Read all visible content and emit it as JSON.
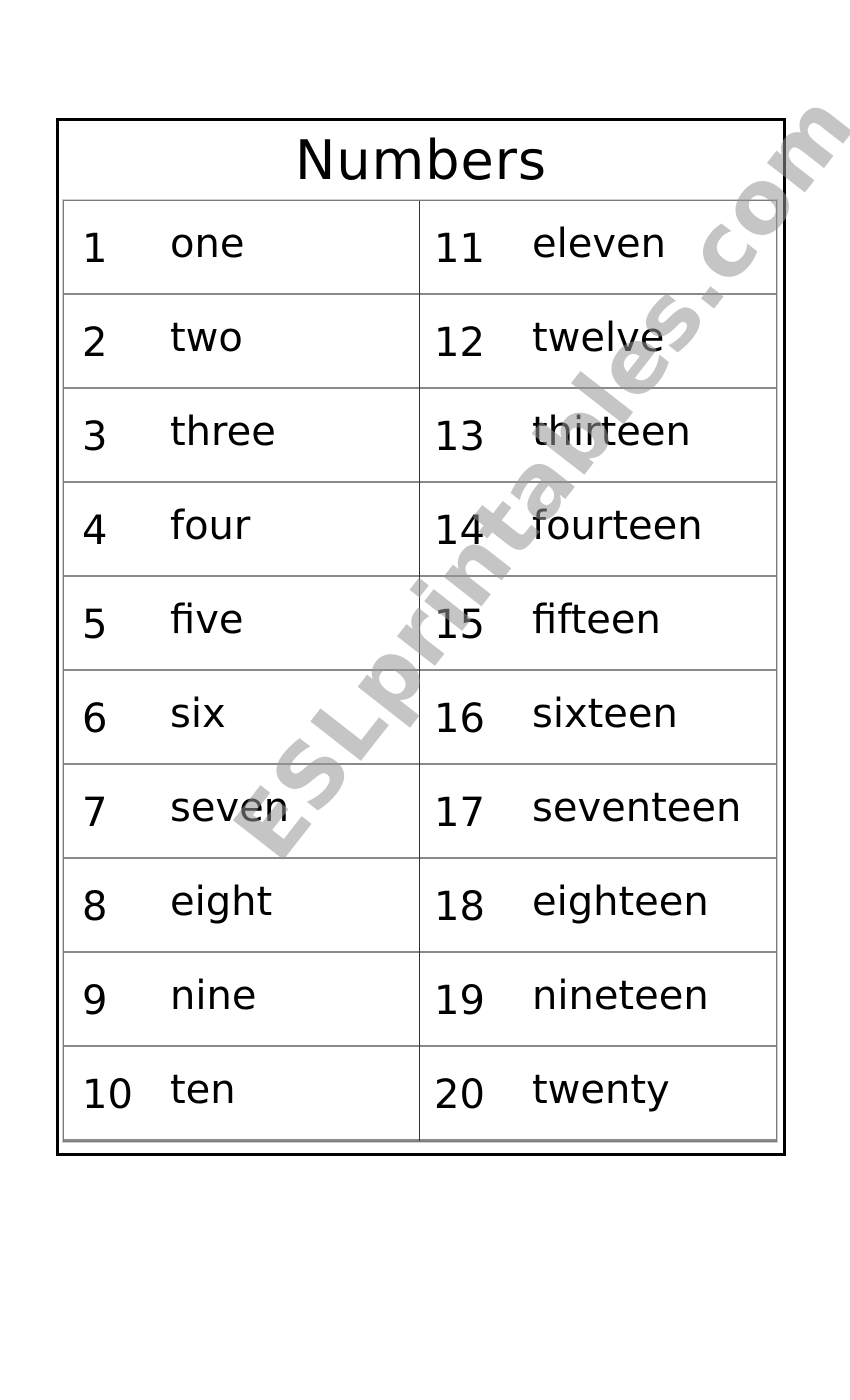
{
  "title": "Numbers",
  "watermark": "ESLprintables.com",
  "rows": [
    {
      "left": {
        "num": "1",
        "word": "one"
      },
      "right": {
        "num": "11",
        "word": "eleven"
      }
    },
    {
      "left": {
        "num": "2",
        "word": "two"
      },
      "right": {
        "num": "12",
        "word": "twelve"
      }
    },
    {
      "left": {
        "num": "3",
        "word": "three"
      },
      "right": {
        "num": "13",
        "word": "thirteen"
      }
    },
    {
      "left": {
        "num": "4",
        "word": "four"
      },
      "right": {
        "num": "14",
        "word": "fourteen"
      }
    },
    {
      "left": {
        "num": "5",
        "word": "five"
      },
      "right": {
        "num": "15",
        "word": "fifteen"
      }
    },
    {
      "left": {
        "num": "6",
        "word": "six"
      },
      "right": {
        "num": "16",
        "word": "sixteen"
      }
    },
    {
      "left": {
        "num": "7",
        "word": "seven"
      },
      "right": {
        "num": "17",
        "word": "seventeen"
      }
    },
    {
      "left": {
        "num": "8",
        "word": "eight"
      },
      "right": {
        "num": "18",
        "word": "eighteen"
      }
    },
    {
      "left": {
        "num": "9",
        "word": "nine"
      },
      "right": {
        "num": "19",
        "word": "nineteen"
      }
    },
    {
      "left": {
        "num": "10",
        "word": "ten"
      },
      "right": {
        "num": "20",
        "word": "twenty"
      }
    }
  ]
}
